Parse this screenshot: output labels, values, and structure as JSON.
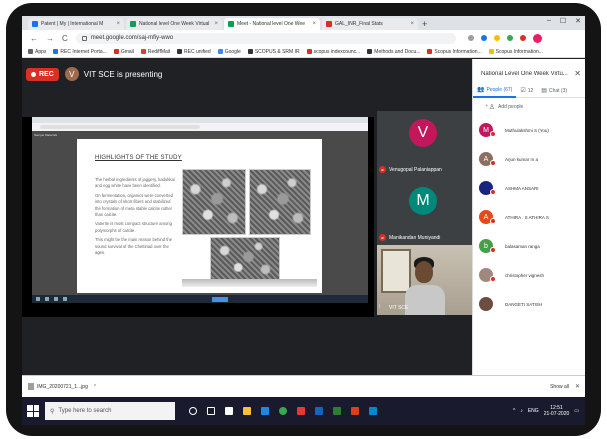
{
  "browser": {
    "tabs": [
      {
        "label": "Patent | My | International M",
        "color": "#1a73e8"
      },
      {
        "label": "National level One Week Virtual",
        "color": "#0f9d58"
      },
      {
        "label": "Meet - National level One Wee",
        "color": "#0f9d58"
      },
      {
        "label": "GAL_INR_Final Stats",
        "color": "#d93025"
      }
    ],
    "new_tab_label": "+",
    "window_controls": [
      "–",
      "☐",
      "✕"
    ],
    "url": "meet.google.com/saj-mfiy-wwo",
    "bookmarks": [
      {
        "label": "Apps",
        "color": "#5f6368"
      },
      {
        "label": "REC Internet Porta...",
        "color": "#1a73e8"
      },
      {
        "label": "Gmail",
        "color": "#d93025"
      },
      {
        "label": "RediffMail",
        "color": "#e53935"
      },
      {
        "label": "REC unified",
        "color": "#333333"
      },
      {
        "label": "Google",
        "color": "#4285f4"
      },
      {
        "label": "SCOPUS & SRM IR",
        "color": "#333333"
      },
      {
        "label": "scopus indexcounc...",
        "color": "#d93025"
      },
      {
        "label": "Methods and Docu...",
        "color": "#333333"
      },
      {
        "label": "Scopus Information...",
        "color": "#d93025"
      },
      {
        "label": "Scopus Information...",
        "color": "#fbbc04"
      }
    ]
  },
  "meet": {
    "rec_label": "REC",
    "presenter_initial": "V",
    "presenting_text": "VIT SCE is presenting",
    "slide": {
      "sidebar_label": "Sample Materials",
      "title": "HIGHLIGHTS OF THE STUDY",
      "paragraphs": [
        "The herbal ingredients of jaggery, kadukkai and egg white have been identified.",
        "On fermentation, organics were converted into crystals of short fibers and stabilized the formation of meta stable calcite rather than calcite.",
        "Vaterite is most compact structure among polymorphs of calcite.",
        "This might be the main reason behind the sound survival of the Chettinad over the ages."
      ]
    },
    "participants_tiles": [
      {
        "initial": "V",
        "name": "Venugopal Palaniappan",
        "color": "#c2185b"
      },
      {
        "initial": "M",
        "name": "Manikandan Muniyandi",
        "color": "#00897b"
      }
    ],
    "video_tile_name": "VIT SCE"
  },
  "people_panel": {
    "title": "National Level One Week Virtu...",
    "close_icon": "✕",
    "tabs": [
      {
        "icon": "people-icon",
        "label": "People (67)"
      },
      {
        "icon": "check-icon",
        "label": "12"
      },
      {
        "icon": "chat-icon",
        "label": "Chat (3)"
      }
    ],
    "add_people_label": "Add people",
    "people": [
      {
        "initial": "M",
        "name": "Muthulakshmi S (You)",
        "color": "#c2185b"
      },
      {
        "initial": "A",
        "name": "Arjun kumar m a",
        "color": "#8d6e63"
      },
      {
        "initial": "",
        "name": "ASHMA ANSARI",
        "color": "#1a237e"
      },
      {
        "initial": "A",
        "name": "ATHIRA . S ATHIRA S",
        "color": "#e64a19"
      },
      {
        "initial": "b",
        "name": "balasaman ranga",
        "color": "#43a047"
      },
      {
        "initial": "",
        "name": "christopher vignesh",
        "color": "#a1887f"
      },
      {
        "initial": "",
        "name": "DANGETI SATISH",
        "color": "#6d4c41"
      }
    ]
  },
  "downloads": {
    "file_name": "IMG_20200721_1...jpg",
    "show_all_label": "Show all",
    "close_icon": "✕"
  },
  "taskbar": {
    "search_placeholder": "Type here to search",
    "tray_text": "ENG",
    "time": "12:51",
    "date": "21-07-2020"
  }
}
